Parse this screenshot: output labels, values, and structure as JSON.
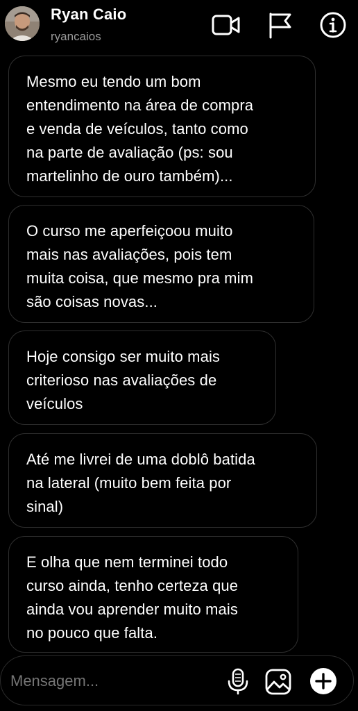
{
  "header": {
    "name": "Ryan Caio",
    "username": "ryancaios",
    "icons": {
      "avatar": "profile-photo",
      "video": "video-camera-icon",
      "flag": "flag-icon",
      "info": "info-icon"
    }
  },
  "messages": [
    {
      "lines": [
        "Mesmo eu tendo um bom",
        "entendimento na área de compra",
        "e venda de veículos, tanto como",
        "na parte de avaliação (ps: sou",
        "martelinho de ouro também)..."
      ]
    },
    {
      "lines": [
        "O curso me aperfeiçoou muito",
        "mais nas avaliações, pois tem",
        "muita coisa, que mesmo pra mim",
        "são coisas novas..."
      ]
    },
    {
      "lines": [
        "Hoje consigo ser muito mais",
        "criterioso nas avaliações de",
        "veículos"
      ]
    },
    {
      "lines": [
        "Até me livrei de uma doblô batida",
        "na lateral (muito bem feita por",
        "sinal)"
      ]
    },
    {
      "lines": [
        "E olha que nem terminei todo",
        "curso ainda, tenho certeza que",
        "ainda vou aprender muito mais",
        "no pouco que falta."
      ]
    }
  ],
  "composer": {
    "placeholder": "Mensagem...",
    "icons": {
      "mic": "microphone-icon",
      "gallery": "image-gallery-icon",
      "plus": "plus-icon"
    }
  },
  "colors": {
    "background": "#000000",
    "bubble_border": "#2f2f2f",
    "text": "#ffffff",
    "secondary_text": "#9a9a9a",
    "placeholder": "#8a8a8a"
  }
}
